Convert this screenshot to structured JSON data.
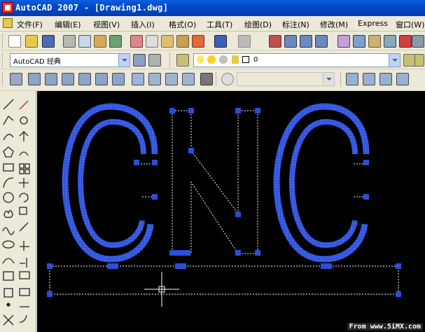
{
  "window": {
    "title": "AutoCAD 2007 - [Drawing1.dwg]"
  },
  "menu": {
    "items": [
      {
        "label": "文件(F)"
      },
      {
        "label": "编辑(E)"
      },
      {
        "label": "视图(V)"
      },
      {
        "label": "插入(I)"
      },
      {
        "label": "格式(O)"
      },
      {
        "label": "工具(T)"
      },
      {
        "label": "绘图(D)"
      },
      {
        "label": "标注(N)"
      },
      {
        "label": "修改(M)"
      },
      {
        "label": "Express"
      },
      {
        "label": "窗口(W)"
      }
    ]
  },
  "workspace": {
    "selected": "AutoCAD 经典"
  },
  "layer": {
    "selected": "0"
  },
  "canvas": {
    "background": "#000000",
    "grip_color": "#2a4fd6",
    "text": "CNC"
  },
  "watermark": {
    "text": "From www.5iMX.com"
  }
}
